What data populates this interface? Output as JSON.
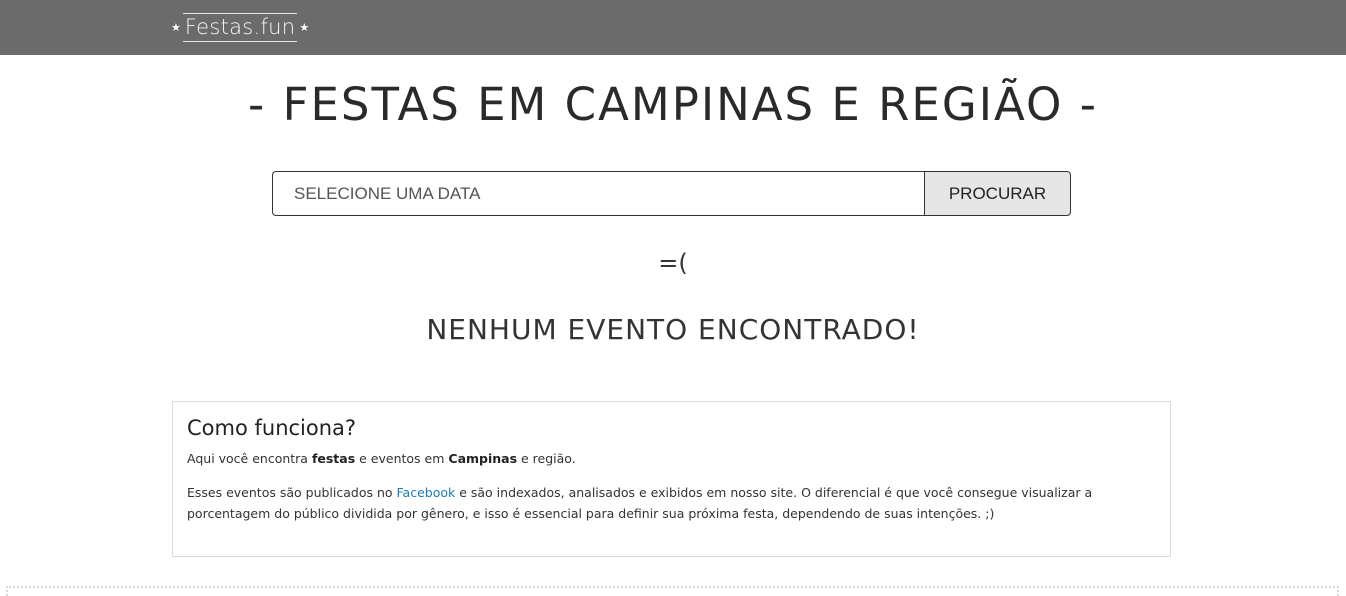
{
  "header": {
    "logo_text": "Festas.fun",
    "logo_star": "★"
  },
  "main": {
    "title": "- FESTAS EM CAMPINAS E REGIÃO -",
    "search": {
      "placeholder": "SELECIONE UMA DATA",
      "button_label": "PROCURAR"
    },
    "empty_state": {
      "emoticon": "=(",
      "message": "NENHUM EVENTO ENCONTRADO!"
    }
  },
  "how_it_works": {
    "heading": "Como funciona?",
    "p1": {
      "t1": "Aqui você encontra ",
      "b1": "festas",
      "t2": " e eventos em ",
      "b2": "Campinas",
      "t3": " e região."
    },
    "p2": {
      "t1": "Esses eventos são publicados no ",
      "link": "Facebook",
      "t2": " e são indexados, analisados e exibidos em nosso site. O diferencial é que você consegue visualizar a porcentagem do público dividida por gênero, e isso é essencial para definir sua próxima festa, dependendo de suas intenções. ;)"
    }
  },
  "colors": {
    "topbar": "#6b6b6b",
    "link": "#1f7bb5",
    "button_bg": "#e6e6e6"
  }
}
